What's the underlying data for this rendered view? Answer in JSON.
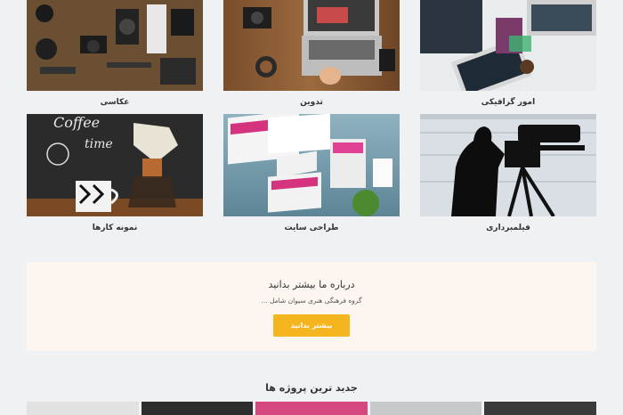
{
  "portfolio": {
    "row1": [
      {
        "label": "امور گرافیکی",
        "image": "graphic-design-photo"
      },
      {
        "label": "تدوین",
        "image": "video-editing-photo"
      },
      {
        "label": "عکاسی",
        "image": "camera-gear-photo"
      }
    ],
    "row2": [
      {
        "label": "فیلمبرداری",
        "image": "filming-photo"
      },
      {
        "label": "طراحی سایت",
        "image": "web-design-photo"
      },
      {
        "label": "نمونه کارها",
        "image": "coffee-chalkboard-photo"
      }
    ]
  },
  "about": {
    "title": "درباره ما بیشتر بدانید",
    "subtitle": "گروه فرهنگی هنری سیوان شامل ...",
    "button": "بیشتر بدانید"
  },
  "latest": {
    "title": "جدید ترین پروژه ها"
  },
  "colors": {
    "accent": "#f5b51f",
    "about_bg": "#fdf6f0",
    "page_bg": "#eff1f3"
  }
}
